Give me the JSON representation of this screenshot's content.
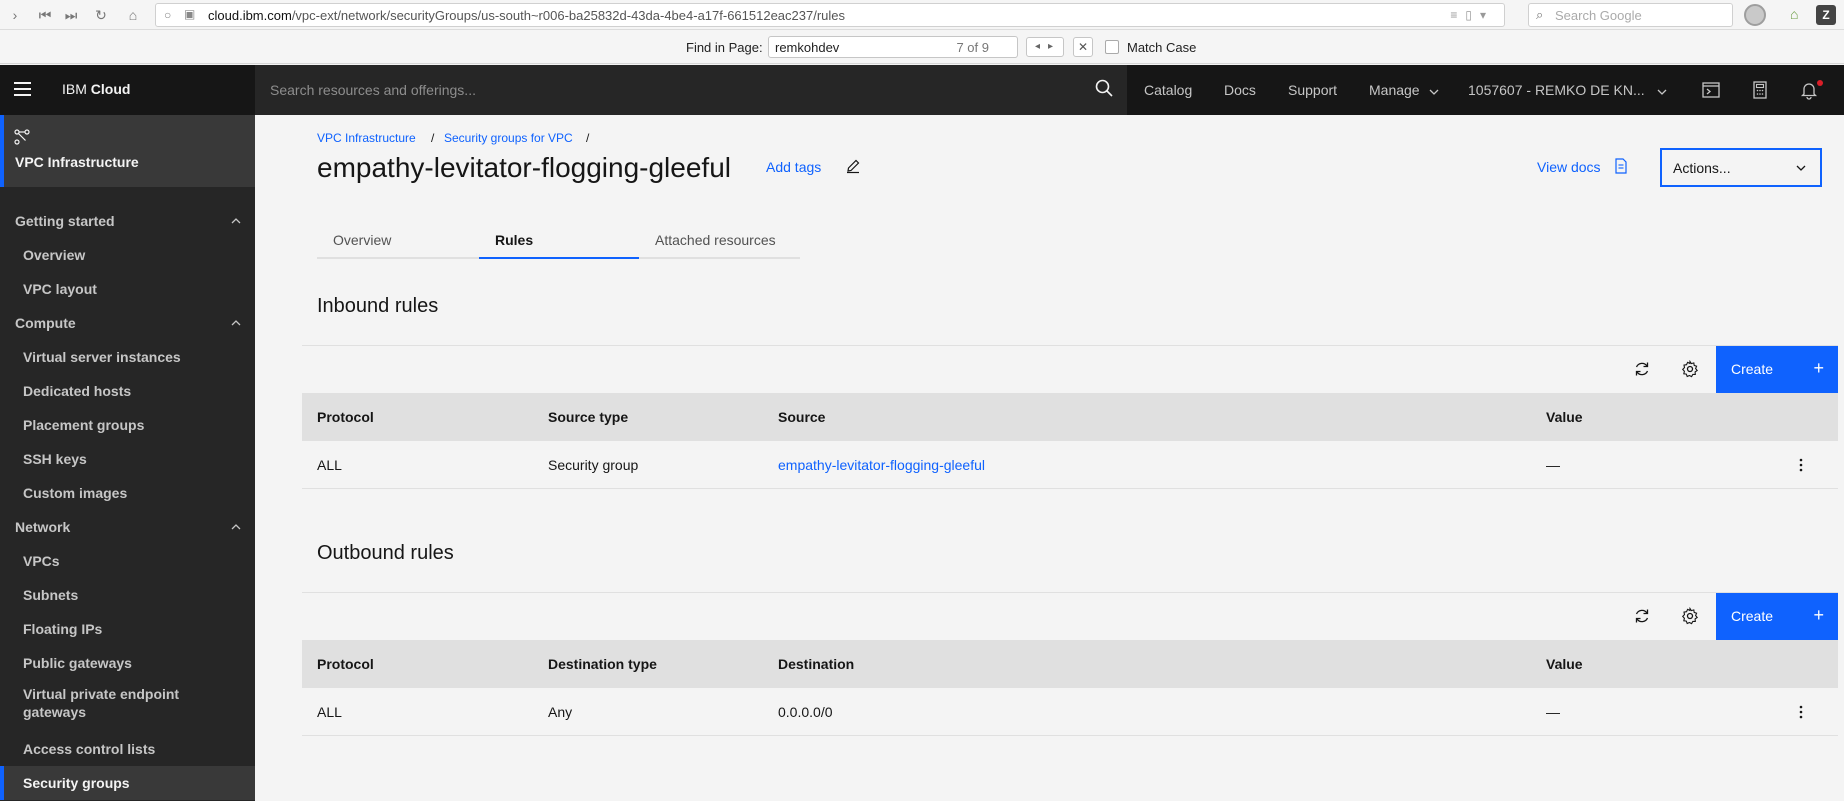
{
  "browser": {
    "url_domain": "cloud.ibm.com",
    "url_path": "/vpc-ext/network/securityGroups/us-south~r006-ba25832d-43da-4be4-a17f-661512eac237/rules",
    "search_placeholder": "Search Google",
    "find_label": "Find in Page:",
    "find_value": "remkohdev",
    "find_count": "7 of 9",
    "match_case_label": "Match Case",
    "ext_z": "Z"
  },
  "header": {
    "brand_prefix": "IBM",
    "brand_name": "Cloud",
    "search_placeholder": "Search resources and offerings...",
    "links": {
      "catalog": "Catalog",
      "docs": "Docs",
      "support": "Support",
      "manage": "Manage",
      "account": "1057607 - REMKO DE KN..."
    }
  },
  "sidebar": {
    "title": "VPC Infrastructure",
    "groups": {
      "getting_started": "Getting started",
      "compute": "Compute",
      "network": "Network"
    },
    "items": {
      "overview": "Overview",
      "vpc_layout": "VPC layout",
      "virtual_server_instances": "Virtual server instances",
      "dedicated_hosts": "Dedicated hosts",
      "placement_groups": "Placement groups",
      "ssh_keys": "SSH keys",
      "custom_images": "Custom images",
      "vpcs": "VPCs",
      "subnets": "Subnets",
      "floating_ips": "Floating IPs",
      "public_gateways": "Public gateways",
      "vpe_gateways_line1": "Virtual private endpoint",
      "vpe_gateways_line2": "gateways",
      "access_control_lists": "Access control lists",
      "security_groups": "Security groups"
    }
  },
  "breadcrumb": {
    "item1": "VPC Infrastructure",
    "item2": "Security groups for VPC",
    "separator": "/"
  },
  "page": {
    "title": "empathy-levitator-flogging-gleeful",
    "add_tags": "Add tags",
    "view_docs": "View docs",
    "actions": "Actions..."
  },
  "tabs": {
    "overview": "Overview",
    "rules": "Rules",
    "attached_resources": "Attached resources"
  },
  "inbound": {
    "title": "Inbound rules",
    "create": "Create",
    "plus": "+",
    "columns": [
      "Protocol",
      "Source type",
      "Source",
      "Value"
    ],
    "rows": [
      {
        "protocol": "ALL",
        "type": "Security group",
        "target": "empathy-levitator-flogging-gleeful",
        "value": "—"
      }
    ]
  },
  "outbound": {
    "title": "Outbound rules",
    "create": "Create",
    "plus": "+",
    "columns": [
      "Protocol",
      "Destination type",
      "Destination",
      "Value"
    ],
    "rows": [
      {
        "protocol": "ALL",
        "type": "Any",
        "target": "0.0.0.0/0",
        "value": "—"
      }
    ]
  },
  "colors": {
    "accent": "#0f62fe",
    "header_bg": "#161616",
    "sidebar_bg": "#262626",
    "notification": "#da1e28"
  }
}
